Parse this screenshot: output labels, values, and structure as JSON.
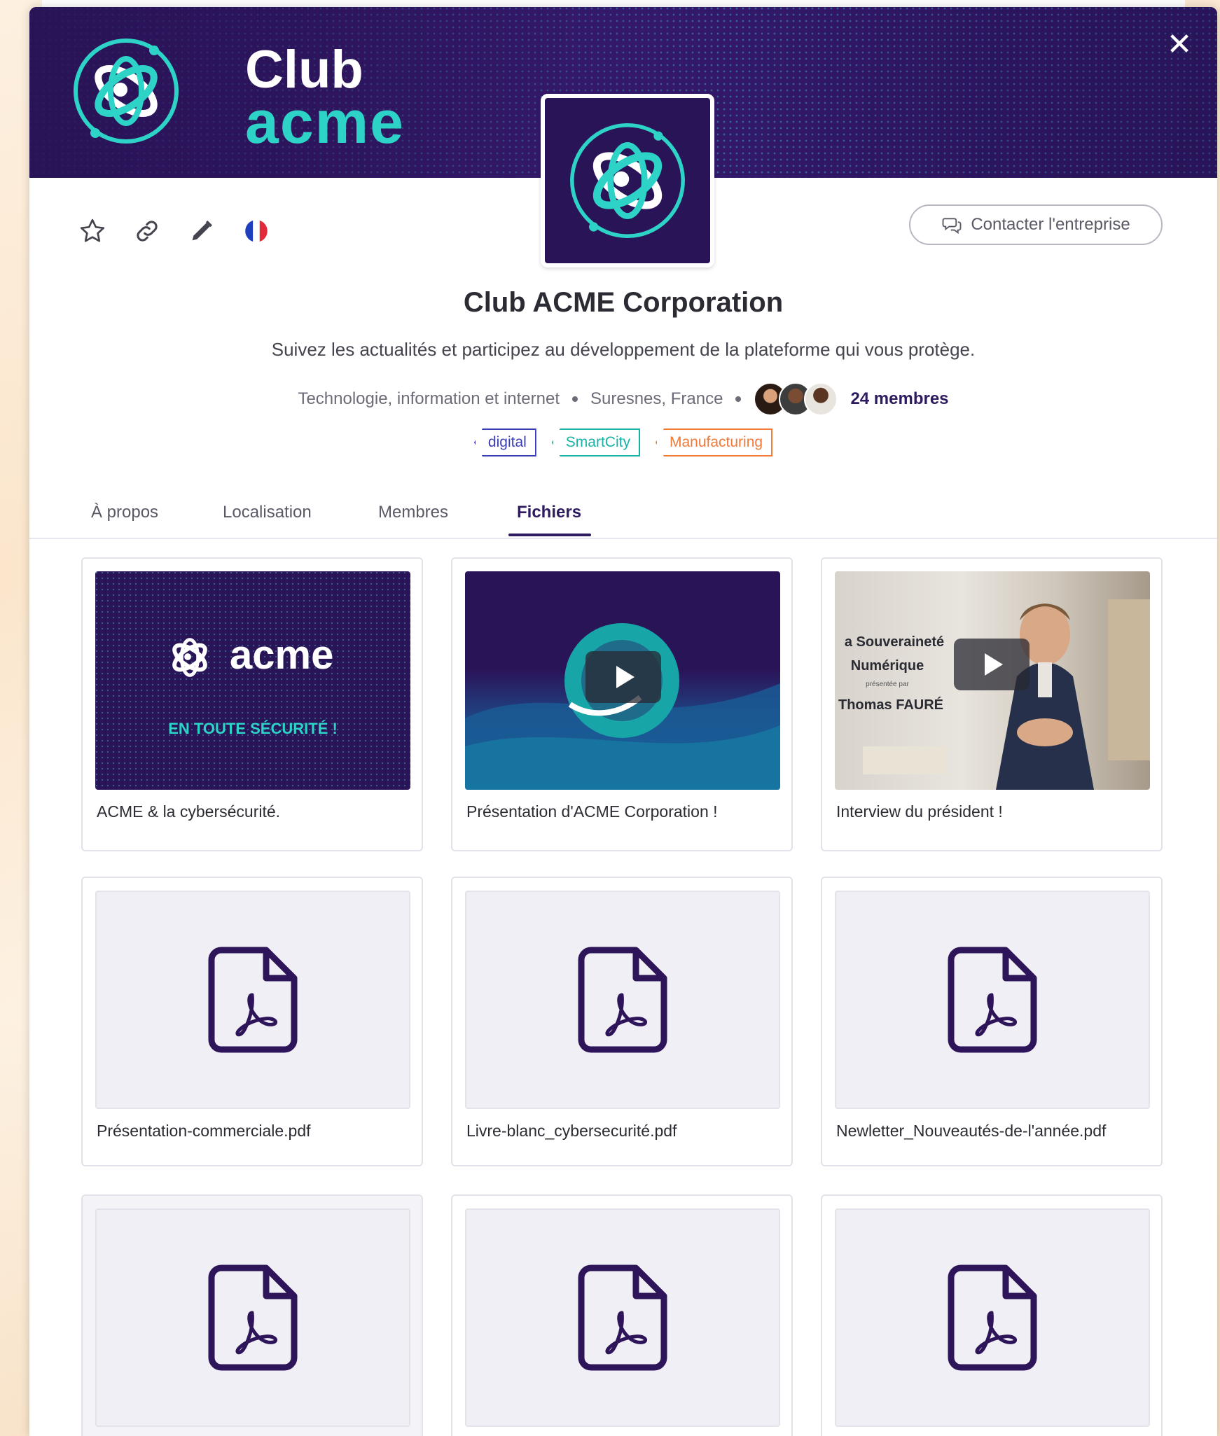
{
  "brand": {
    "line1": "Club",
    "line2": "acme"
  },
  "header": {
    "close_icon": "close-icon",
    "contact_button": "Contacter l'entreprise"
  },
  "action_icons": [
    "star-icon",
    "link-icon",
    "pencil-icon",
    "france-flag-icon"
  ],
  "company": {
    "name": "Club ACME Corporation",
    "tagline": "Suivez les actualités et participez au développement de la plateforme qui vous protège.",
    "industry": "Technologie, information et internet",
    "location": "Suresnes, France",
    "members": "24 membres"
  },
  "tags": [
    {
      "label": "digital",
      "color": "#3b3fb5"
    },
    {
      "label": "SmartCity",
      "color": "#18b3a7"
    },
    {
      "label": "Manufacturing",
      "color": "#f07a3a"
    }
  ],
  "tabs": [
    {
      "label": "À propos"
    },
    {
      "label": "Localisation"
    },
    {
      "label": "Membres"
    },
    {
      "label": "Fichiers",
      "active": true
    }
  ],
  "files": [
    {
      "label": "ACME & la cybersécurité.",
      "kind": "image",
      "thumb_text": {
        "logo": "acme",
        "slogan": "EN TOUTE SÉCURITÉ !"
      }
    },
    {
      "label": "Présentation d'ACME Corporation !",
      "kind": "video"
    },
    {
      "label": "Interview du président !",
      "kind": "video",
      "thumb_text": {
        "line1": "a Souveraineté",
        "line2": "Numérique",
        "line3": "présentée par",
        "line4": "Thomas FAURÉ"
      }
    },
    {
      "label": "Présentation-commerciale.pdf",
      "kind": "pdf"
    },
    {
      "label": "Livre-blanc_cybersecurité.pdf",
      "kind": "pdf"
    },
    {
      "label": "Newletter_Nouveautés-de-l'année.pdf",
      "kind": "pdf"
    },
    {
      "label": "",
      "kind": "pdf"
    },
    {
      "label": "",
      "kind": "pdf"
    },
    {
      "label": "",
      "kind": "pdf"
    }
  ],
  "colors": {
    "brand_dark": "#2a1458",
    "brand_teal": "#2ed3c7",
    "active_tab": "#2e1a5e"
  }
}
